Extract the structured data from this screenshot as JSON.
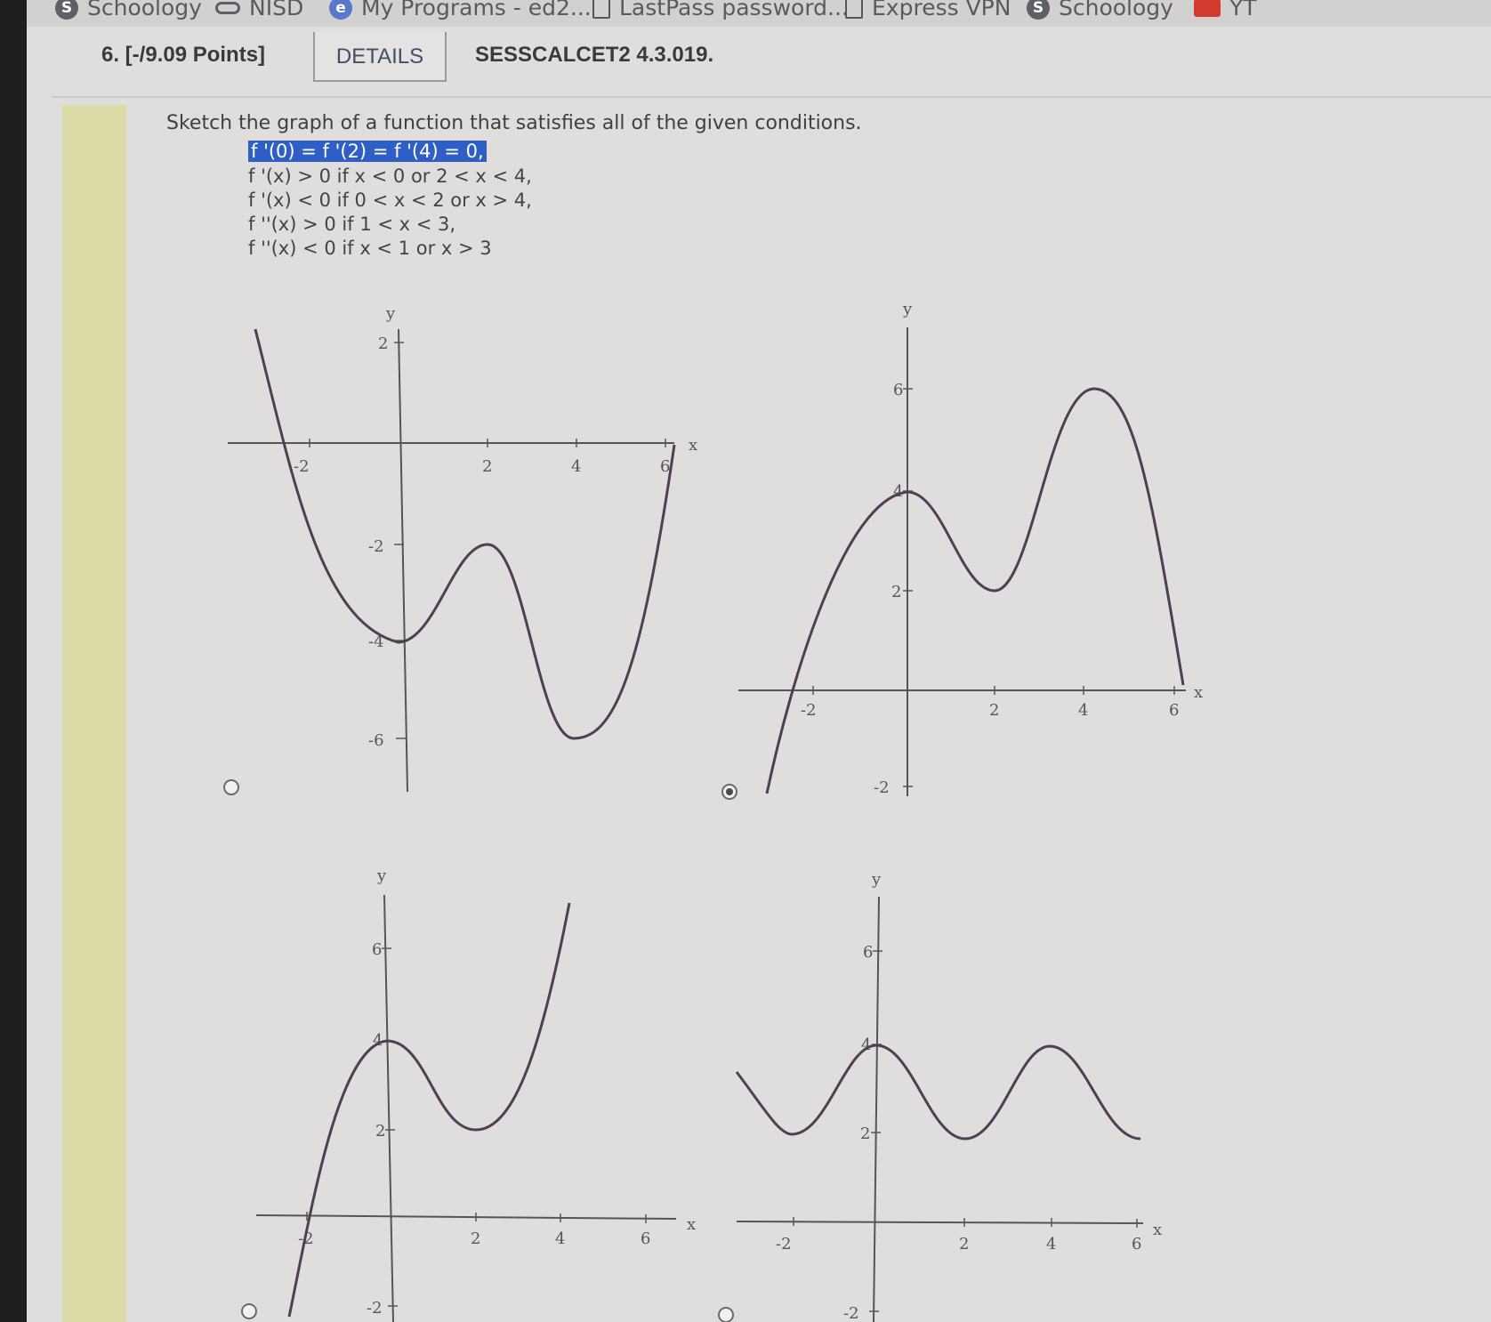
{
  "bookmarks": [
    {
      "label": "Schoology",
      "icon": "schoology-icon"
    },
    {
      "label": "NISD",
      "icon": "link-icon"
    },
    {
      "label": "My Programs - ed2...",
      "icon": "edge-icon"
    },
    {
      "label": "LastPass password...",
      "icon": "document-icon"
    },
    {
      "label": "Express VPN",
      "icon": "document-icon"
    },
    {
      "label": "Schoology",
      "icon": "schoology-icon"
    },
    {
      "label": "YT",
      "icon": "youtube-icon"
    }
  ],
  "question": {
    "number": "6.  [-/9.09 Points]",
    "details_label": "DETAILS",
    "code": "SESSCALCET2 4.3.019."
  },
  "prompt": "Sketch the graph of a function that satisfies all of the given conditions.",
  "conditions": [
    "f '(0) = f '(2) = f '(4) = 0,",
    "f '(x) > 0 if x < 0 or 2 < x < 4,",
    "f '(x) < 0 if 0 < x < 2 or x > 4,",
    "f ''(x) > 0 if 1 < x < 3,",
    "f ''(x) < 0 if x < 1 or x > 3"
  ],
  "graphs": [
    {
      "option": "A",
      "selected": false,
      "y_label": "y",
      "x_label": "x",
      "y_ticks": [
        "2",
        "-2",
        "-4",
        "-6"
      ],
      "x_ticks": [
        "-2",
        "2",
        "4",
        "6"
      ],
      "curve_desc": "local min at x=0 (y=-4), local max at x=2 (y=-2), local min at x=4 (y=-6)"
    },
    {
      "option": "B",
      "selected": true,
      "y_label": "y",
      "x_label": "x",
      "y_ticks": [
        "6",
        "4",
        "2",
        "-2"
      ],
      "x_ticks": [
        "-2",
        "2",
        "4",
        "6"
      ],
      "curve_desc": "local max at x=0 (y=4), local min at x=2 (y=2), local max at x=4 (y=6)"
    },
    {
      "option": "C",
      "selected": false,
      "y_label": "y",
      "x_label": "x",
      "y_ticks": [
        "6",
        "4",
        "2",
        "-2"
      ],
      "x_ticks": [
        "-2",
        "2",
        "4",
        "6"
      ],
      "curve_desc": "local max at x=0 (y=4), local min at x=2 (y=2), increasing after"
    },
    {
      "option": "D",
      "selected": false,
      "y_label": "y",
      "x_label": "x",
      "y_ticks": [
        "6",
        "4",
        "2",
        "-2"
      ],
      "x_ticks": [
        "-2",
        "2",
        "4",
        "6"
      ],
      "curve_desc": "periodic wave with maxima near x=0 and x=4, minima near x=-2, x=2, x=6"
    }
  ],
  "colors": {
    "curve": "#4f3f55",
    "axis": "#555558",
    "selection_highlight": "#2f5fc4"
  }
}
